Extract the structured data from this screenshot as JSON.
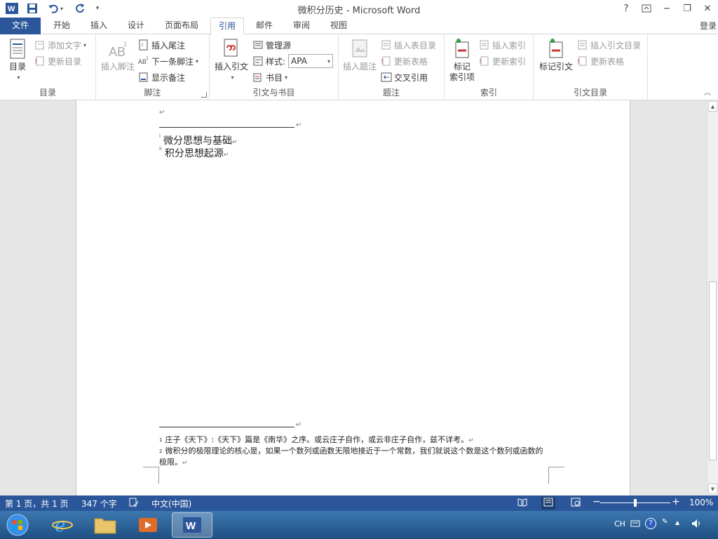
{
  "window": {
    "title": "微积分历史 - Microsoft Word",
    "help": "?",
    "minimize": "−",
    "restore": "❐",
    "close": "✕"
  },
  "tabs": {
    "file": "文件",
    "items": [
      "开始",
      "插入",
      "设计",
      "页面布局",
      "引用",
      "邮件",
      "审阅",
      "视图"
    ],
    "active": "引用",
    "login": "登录"
  },
  "ribbon": {
    "toc": {
      "label": "目录",
      "add_text": "添加文字",
      "update_toc": "更新目录",
      "group": "目录"
    },
    "footnotes": {
      "insert_footnote": "插入脚注",
      "insert_endnote": "插入尾注",
      "next_footnote": "下一条脚注",
      "show_notes": "显示备注",
      "group": "脚注"
    },
    "citations": {
      "insert_citation": "插入引文",
      "manage_sources": "管理源",
      "style_label": "样式:",
      "style_value": "APA",
      "bibliography": "书目",
      "group": "引文与书目"
    },
    "captions": {
      "insert_caption": "插入题注",
      "insert_table_of_figures": "插入表目录",
      "update_table": "更新表格",
      "cross_reference": "交叉引用",
      "group": "题注"
    },
    "index": {
      "mark_entry_line1": "标记",
      "mark_entry_line2": "索引项",
      "insert_index": "插入索引",
      "update_index": "更新索引",
      "group": "索引"
    },
    "toa": {
      "mark_citation": "标记引文",
      "insert_toa": "插入引文目录",
      "update_table": "更新表格",
      "group": "引文目录"
    }
  },
  "document": {
    "paragraph_mark": "↵",
    "endnotes": [
      {
        "marker": "i",
        "text": "微分思想与基础"
      },
      {
        "marker": "ii",
        "text": "积分思想起源"
      }
    ],
    "footnotes": [
      {
        "marker": "1",
        "text": "庄子《天下》:《天下》篇是《南华》之序。或云庄子自作，或云非庄子自作，兹不详考。"
      },
      {
        "marker": "2",
        "text": "微积分的极限理论的核心是，如果一个数列或函数无限地接近于一个常数，我们就说这个数是这个数列或函数的极限。"
      }
    ]
  },
  "statusbar": {
    "page_info": "第 1 页，共 1 页",
    "word_count": "347 个字",
    "language": "中文(中国)",
    "zoom": "100%",
    "zoom_level": 100
  },
  "taskbar": {
    "tray_language": "CH"
  },
  "colors": {
    "accent": "#2b579a",
    "taskbar": "#1f4f82"
  }
}
